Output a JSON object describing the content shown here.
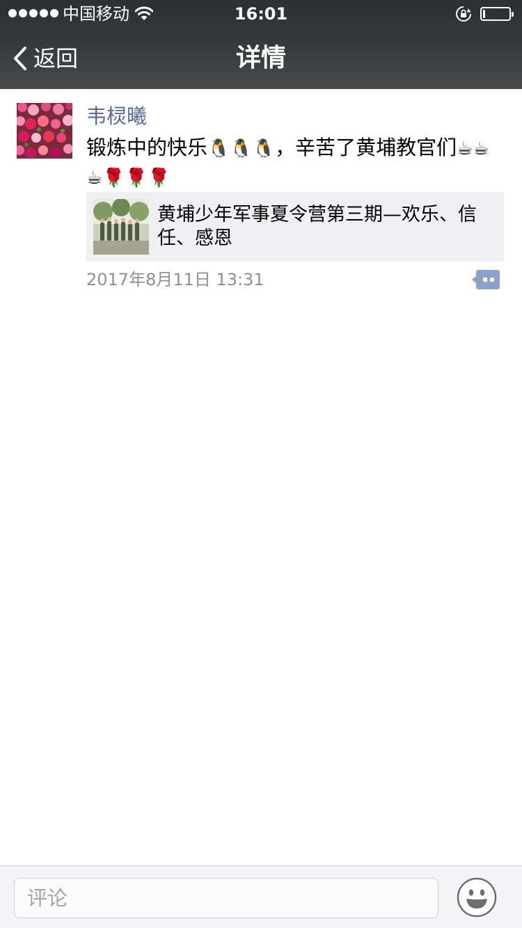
{
  "status_bar": {
    "carrier": "中国移动",
    "time": "16:01",
    "battery_level": 0.05,
    "icons": [
      "signal-dots-icon",
      "wifi-icon",
      "rotation-lock-icon",
      "battery-icon"
    ]
  },
  "nav": {
    "back_label": "返回",
    "title": "详情"
  },
  "post": {
    "author": "韦棂曦",
    "text_main": "锻炼中的快乐",
    "text_penguins": "🐧🐧🐧",
    "text_middle": "，辛苦了黄埔教官们",
    "text_coffee": "☕☕☕",
    "text_roses": "🌹🌹🌹",
    "link_title": "黄埔少年军事夏令营第三期—欢乐、信任、感恩",
    "timestamp": "2017年8月11日 13:31"
  },
  "comment": {
    "placeholder": "评论"
  },
  "colors": {
    "author_name": "#576b95",
    "timestamp": "#8f8f8f",
    "nav_background": "#3b3c40",
    "card_background": "#f0f0f2",
    "comment_icon": "#8ea1cb"
  }
}
